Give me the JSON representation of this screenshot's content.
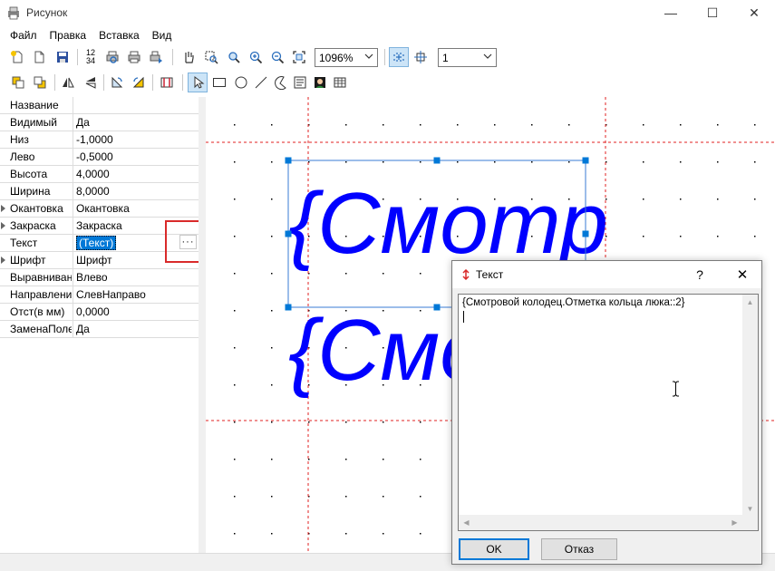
{
  "window": {
    "title": "Рисунок",
    "minimize_glyph": "—",
    "maximize_glyph": "☐",
    "close_glyph": "✕"
  },
  "menu": [
    "Файл",
    "Правка",
    "Вставка",
    "Вид"
  ],
  "toolbar1": {
    "zoom": "1096%",
    "layer": "1",
    "page_numbers_glyph_top": "12",
    "page_numbers_glyph_bottom": "34"
  },
  "properties": [
    {
      "name": "Название",
      "value": "",
      "expandable": false
    },
    {
      "name": "Видимый",
      "value": "Да",
      "expandable": false
    },
    {
      "name": "Низ",
      "value": "-1,0000",
      "expandable": false
    },
    {
      "name": "Лево",
      "value": "-0,5000",
      "expandable": false
    },
    {
      "name": "Высота",
      "value": "4,0000",
      "expandable": false
    },
    {
      "name": "Ширина",
      "value": "8,0000",
      "expandable": false
    },
    {
      "name": "Окантовка",
      "value": "Окантовка",
      "expandable": true
    },
    {
      "name": "Закраска",
      "value": "Закраска",
      "expandable": true
    },
    {
      "name": "Текст",
      "value": "(Текст)",
      "expandable": false,
      "selected": true
    },
    {
      "name": "Шрифт",
      "value": "Шрифт",
      "expandable": true
    },
    {
      "name": "Выравнивание",
      "value": "Влево",
      "expandable": false
    },
    {
      "name": "Направление",
      "value": "СлевНаправо",
      "expandable": false
    },
    {
      "name": "Отст(в мм)",
      "value": "0,0000",
      "expandable": false
    },
    {
      "name": "ЗаменаПолей",
      "value": "Да",
      "expandable": false
    }
  ],
  "ellipsis_label": "···",
  "canvas": {
    "text_line1": "{Смотр",
    "text_line2": "{Смотр",
    "text_color": "#0000ff",
    "guide_color": "#e02020",
    "handle_color": "#0078d7"
  },
  "dialog": {
    "title": "Текст",
    "help": "?",
    "close": "✕",
    "text_value": "{Смотровой колодец.Отметка кольца люка::2}",
    "ok_label": "OK",
    "cancel_label": "Отказ"
  }
}
